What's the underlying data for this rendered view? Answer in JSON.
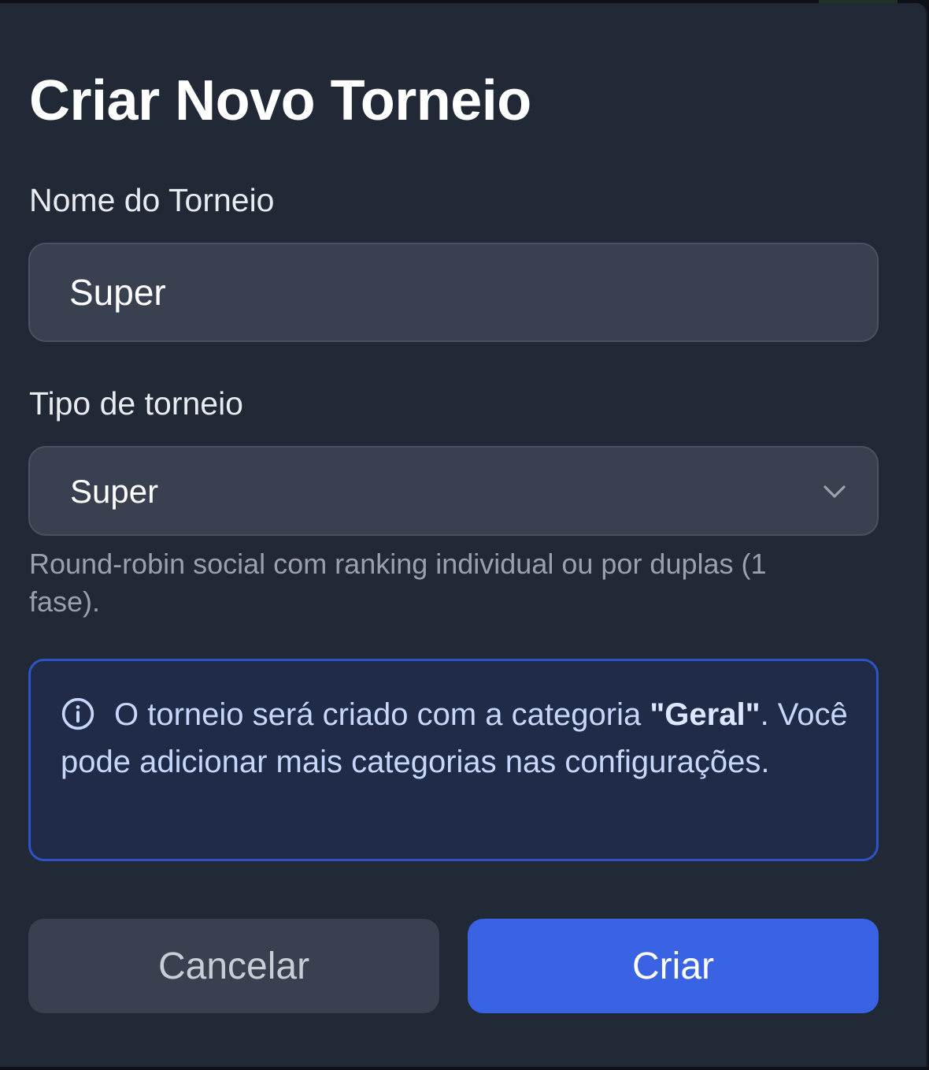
{
  "modal": {
    "title": "Criar Novo Torneio"
  },
  "fields": {
    "name_label": "Nome do Torneio",
    "name_value": "Super",
    "type_label": "Tipo de torneio",
    "type_selected": "Super",
    "type_helper": "Round-robin social com ranking individual ou por duplas (1 fase)."
  },
  "info": {
    "icon": "info-circle-icon",
    "text_before": "O torneio será criado com a categoria ",
    "category": "\"Geral\"",
    "text_after": ". Você pode adicionar mais categorias nas configurações."
  },
  "buttons": {
    "cancel": "Cancelar",
    "create": "Criar"
  },
  "colors": {
    "modal_bg": "#222936",
    "field_bg": "#394050",
    "info_bg": "#202b47",
    "info_border": "#2f52c6",
    "primary": "#3a63e4"
  }
}
